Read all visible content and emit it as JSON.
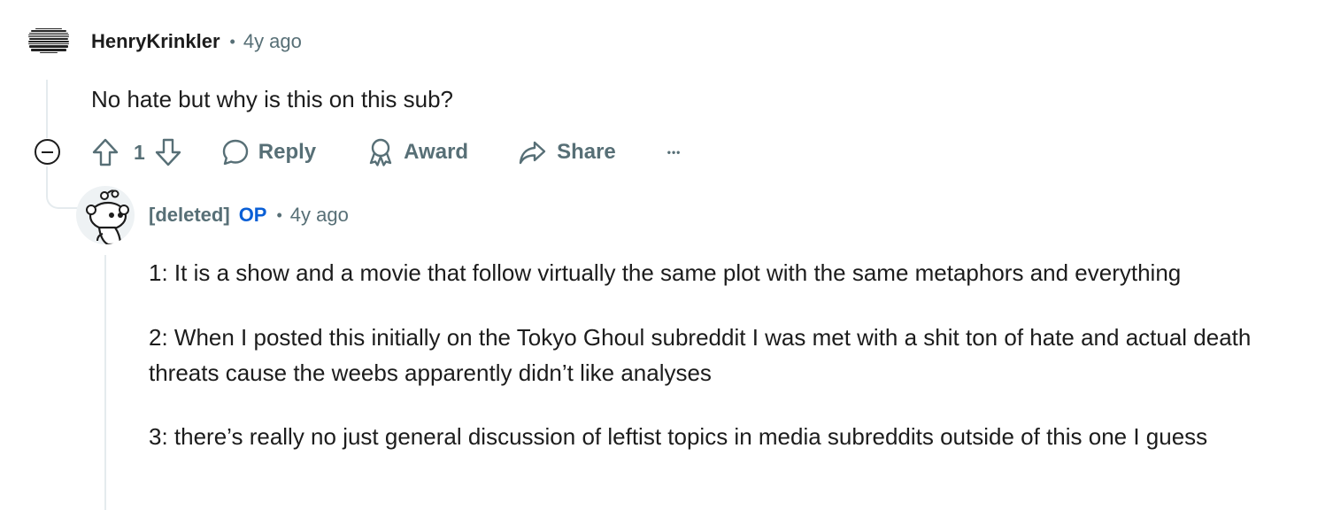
{
  "comment1": {
    "author": "HenryKrinkler",
    "separator": "•",
    "time": "4y ago",
    "body": "No hate but why is this on this sub?",
    "actions": {
      "vote_count": "1",
      "reply_label": "Reply",
      "award_label": "Award",
      "share_label": "Share",
      "more_label": "•••"
    }
  },
  "comment2": {
    "author": "[deleted]",
    "op_badge": "OP",
    "separator": "•",
    "time": "4y ago",
    "paragraphs": [
      "1: It is a show and a movie that follow virtually the same plot with the same metaphors and everything",
      "2: When I posted this initially on the Tokyo Ghoul subreddit I was met with a shit ton of hate and actual death threats cause the weebs apparently didn’t like analyses",
      "3: there’s really no just general discussion of leftist topics in media subreddits outside of this one I guess"
    ]
  },
  "icons": [
    "collapse-icon",
    "upvote-icon",
    "downvote-icon",
    "reply-icon",
    "award-icon",
    "share-icon",
    "more-icon"
  ],
  "colors": {
    "meta": "#576f76",
    "op": "#0a5fd6",
    "thread": "#e5ebee",
    "text": "#1c1c1c"
  }
}
